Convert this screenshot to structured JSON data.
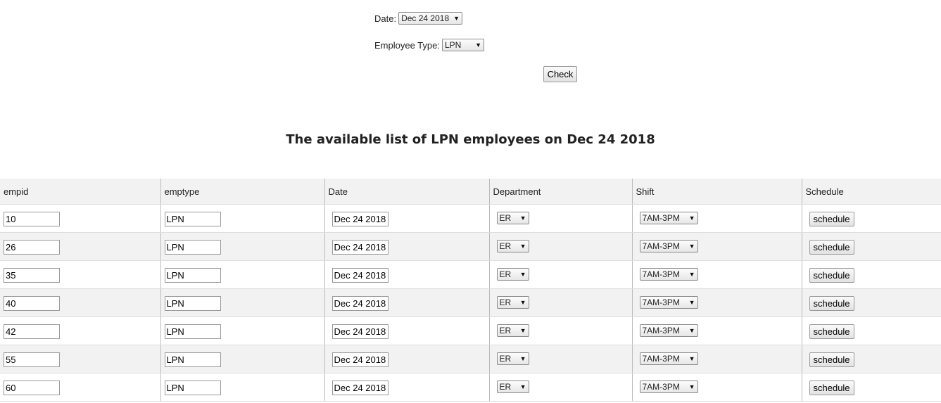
{
  "form": {
    "date_label": "Date:",
    "date_value": "Dec 24 2018",
    "type_label": "Employee Type:",
    "type_value": "LPN",
    "check_label": "Check"
  },
  "heading": "The available list of LPN employees on Dec 24 2018",
  "table": {
    "headers": [
      "empid",
      "emptype",
      "Date",
      "Department",
      "Shift",
      "Schedule"
    ],
    "rows": [
      {
        "empid": "10",
        "emptype": "LPN",
        "date": "Dec 24 2018",
        "department": "ER",
        "shift": "7AM-3PM",
        "action": "schedule"
      },
      {
        "empid": "26",
        "emptype": "LPN",
        "date": "Dec 24 2018",
        "department": "ER",
        "shift": "7AM-3PM",
        "action": "schedule"
      },
      {
        "empid": "35",
        "emptype": "LPN",
        "date": "Dec 24 2018",
        "department": "ER",
        "shift": "7AM-3PM",
        "action": "schedule"
      },
      {
        "empid": "40",
        "emptype": "LPN",
        "date": "Dec 24 2018",
        "department": "ER",
        "shift": "7AM-3PM",
        "action": "schedule"
      },
      {
        "empid": "42",
        "emptype": "LPN",
        "date": "Dec 24 2018",
        "department": "ER",
        "shift": "7AM-3PM",
        "action": "schedule"
      },
      {
        "empid": "55",
        "emptype": "LPN",
        "date": "Dec 24 2018",
        "department": "ER",
        "shift": "7AM-3PM",
        "action": "schedule"
      },
      {
        "empid": "60",
        "emptype": "LPN",
        "date": "Dec 24 2018",
        "department": "ER",
        "shift": "7AM-3PM",
        "action": "schedule"
      }
    ]
  },
  "icons": {
    "dropdown_arrow": "chevron-down-icon"
  }
}
